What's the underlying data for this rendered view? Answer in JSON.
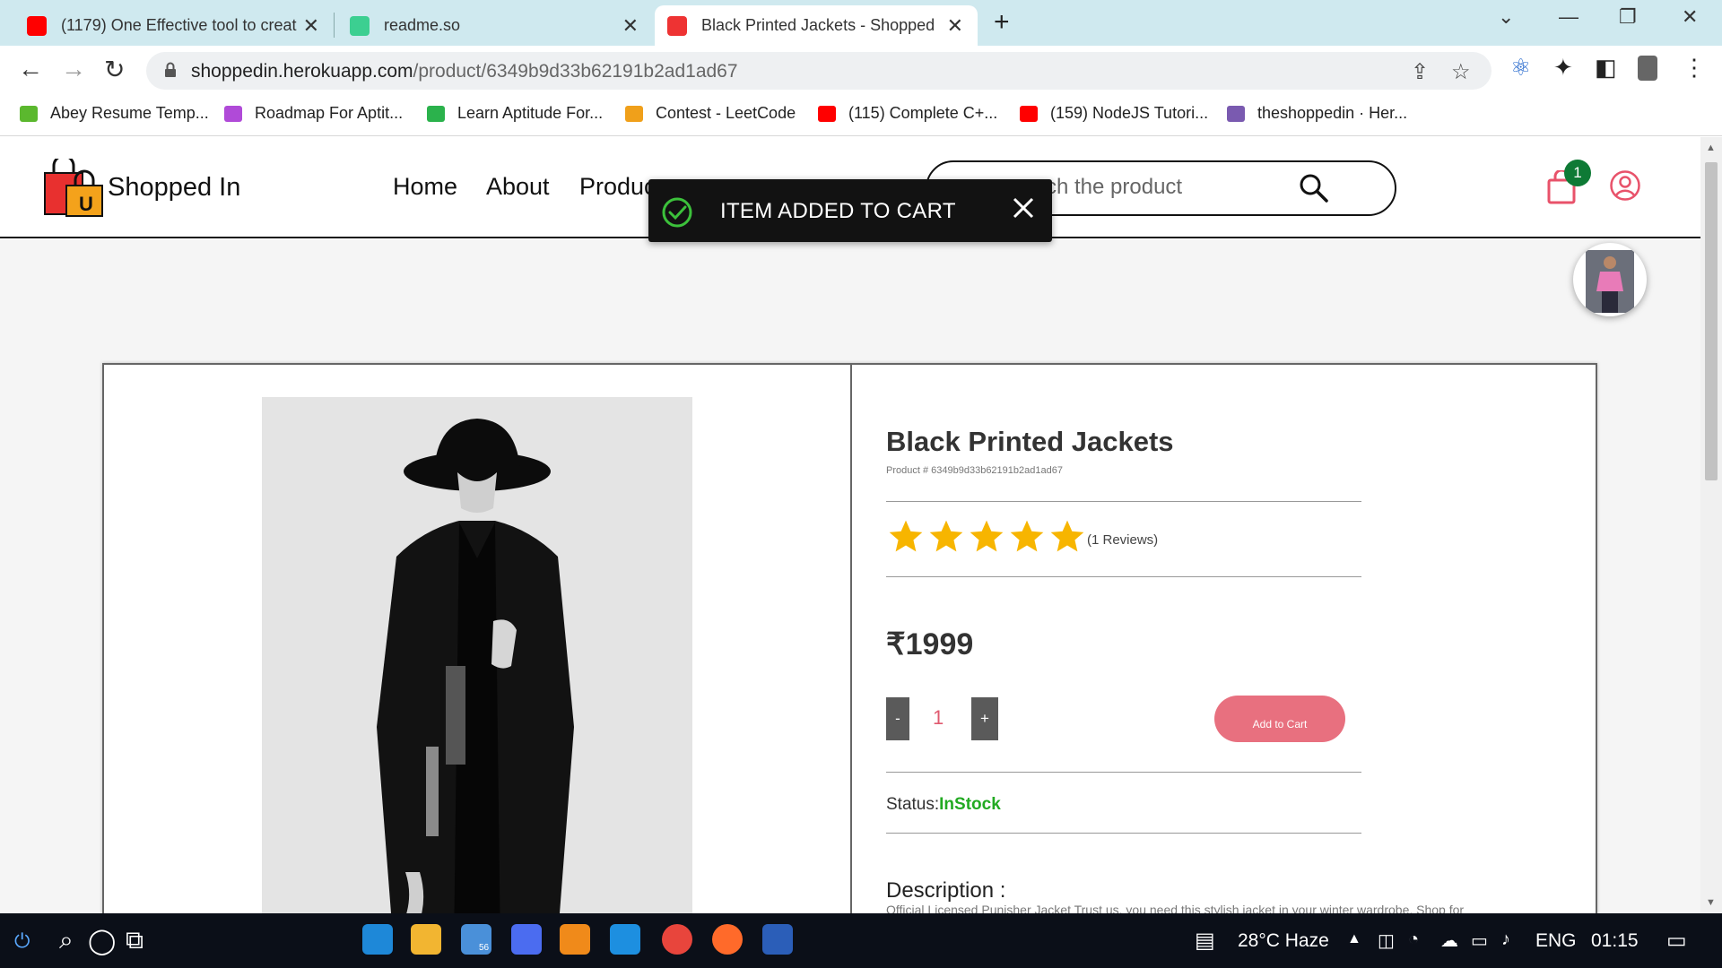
{
  "browser": {
    "tabs": [
      {
        "title": "(1179) One Effective tool to creat",
        "favicon": "youtube-icon",
        "color": "#ff0000"
      },
      {
        "title": "readme.so",
        "favicon": "readme-icon",
        "color": "#3ccf91"
      },
      {
        "title": "Black Printed Jackets - ShoppedIn",
        "favicon": "shopping-bag-icon",
        "color": "#e33"
      }
    ],
    "new_tab": "+",
    "url_host": "shoppedin.herokuapp.com",
    "url_path": "/product/6349b9d33b62191b2ad1ad67",
    "bookmarks": [
      {
        "label": "Abey Resume Temp...",
        "icon": "resume-icon",
        "color": "#5bb82e"
      },
      {
        "label": "Roadmap For Aptit...",
        "icon": "roadmap-icon",
        "color": "#b04ad8"
      },
      {
        "label": "Learn Aptitude For...",
        "icon": "aptitude-icon",
        "color": "#2bb24c"
      },
      {
        "label": "Contest - LeetCode",
        "icon": "leetcode-icon",
        "color": "#f0a01a"
      },
      {
        "label": "(115) Complete C+...",
        "icon": "youtube-icon",
        "color": "#ff0000"
      },
      {
        "label": "(159) NodeJS Tutori...",
        "icon": "youtube-icon",
        "color": "#ff0000"
      },
      {
        "label": "theshoppedin · Her...",
        "icon": "heroku-icon",
        "color": "#7a5ab0"
      }
    ]
  },
  "site": {
    "brand": "Shopped In",
    "nav": [
      "Home",
      "About",
      "Produc"
    ],
    "search_placeholder": "ch the product",
    "cart_count": "1",
    "accent_color": "#e8707f"
  },
  "toast": {
    "message": "ITEM ADDED TO CART"
  },
  "product": {
    "name": "Black Printed Jackets",
    "id_text": "Product # 6349b9d33b62191b2ad1ad67",
    "rating": 5,
    "rating_max": 5,
    "reviews": "(1 Reviews)",
    "price": "₹1999",
    "minus": "-",
    "plus": "+",
    "quantity": "1",
    "add_to_cart": "Add to Cart",
    "status_label": "Status:",
    "status_value": "InStock",
    "description_label": "Description :",
    "description": "Official Licensed Punisher Jacket Trust us, you need this stylish jacket in your winter wardrobe. Shop for"
  },
  "taskbar": {
    "weather": "28°C  Haze",
    "language": "ENG",
    "time": "01:15",
    "mail_badge": "56"
  }
}
